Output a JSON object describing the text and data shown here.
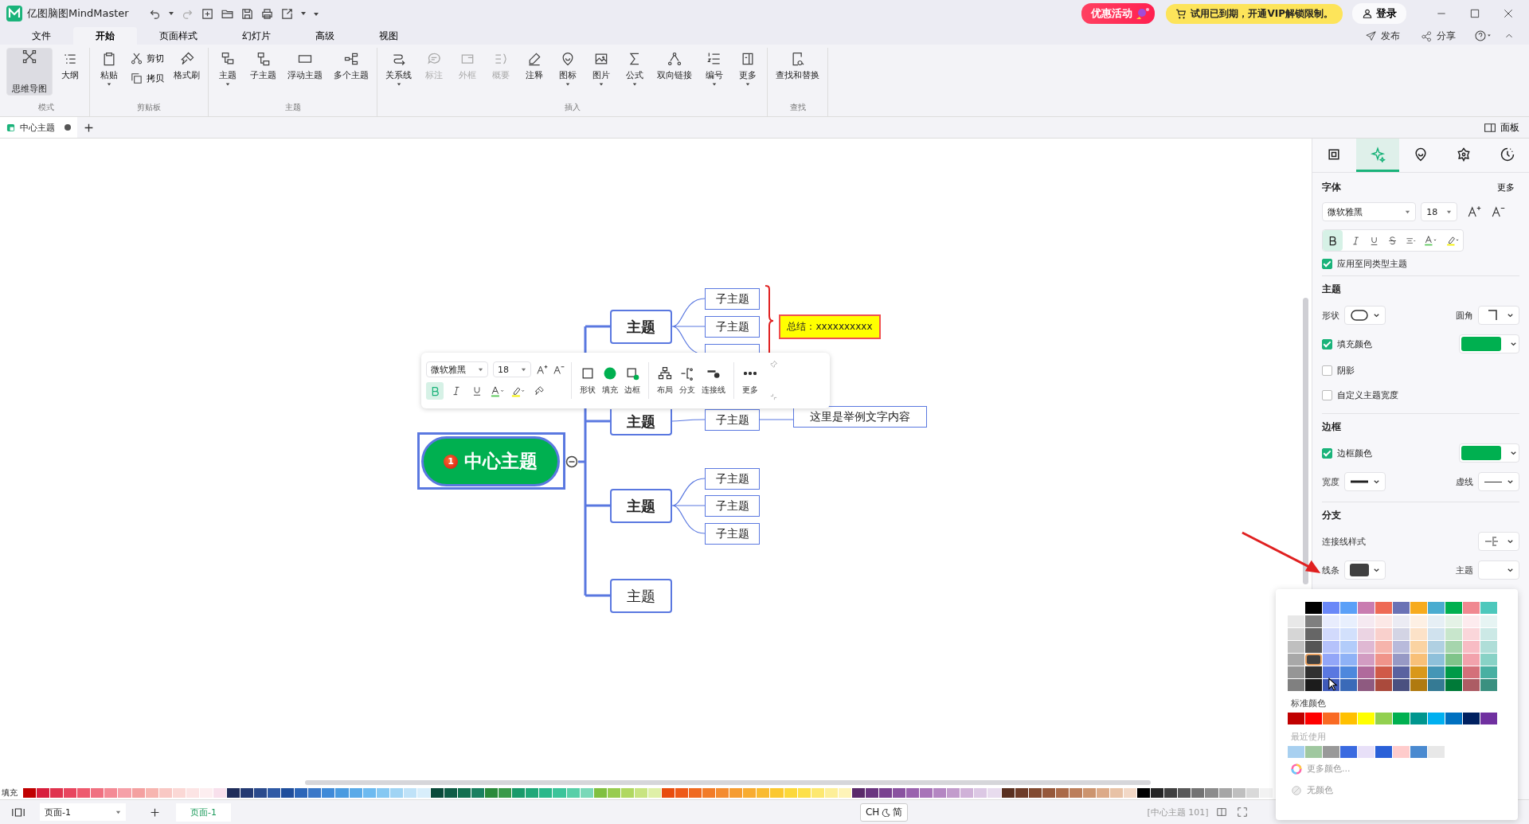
{
  "app": {
    "title": "亿图脑图MindMaster"
  },
  "promo": {
    "label": "优惠活动"
  },
  "vip_notice": {
    "label": "试用已到期，开通VIP解锁限制。"
  },
  "login": {
    "label": "登录"
  },
  "header_actions": [
    {
      "label": "发布"
    },
    {
      "label": "分享"
    }
  ],
  "menu_tabs": [
    {
      "label": "文件",
      "selected": false
    },
    {
      "label": "开始",
      "selected": true
    },
    {
      "label": "页面样式",
      "selected": false
    },
    {
      "label": "幻灯片",
      "selected": false
    },
    {
      "label": "高级",
      "selected": false
    },
    {
      "label": "视图",
      "selected": false
    }
  ],
  "ribbon_groups": [
    {
      "label": "模式",
      "items": [
        {
          "label": "思维导图",
          "kind": "large",
          "caret": false,
          "disabled": false,
          "selected": true
        },
        {
          "label": "大纲",
          "kind": "large",
          "caret": false,
          "disabled": false,
          "selected": false
        }
      ]
    },
    {
      "label": "剪贴板",
      "items": [
        {
          "label": "粘贴",
          "kind": "large",
          "caret": true,
          "disabled": false
        },
        {
          "label": "剪切",
          "kind": "small",
          "caret": false,
          "disabled": false
        },
        {
          "label": "拷贝",
          "kind": "small",
          "caret": false,
          "disabled": false
        },
        {
          "label": "格式刷",
          "kind": "large",
          "caret": false,
          "disabled": false
        }
      ]
    },
    {
      "label": "主题",
      "items": [
        {
          "label": "主题",
          "kind": "large",
          "caret": true,
          "disabled": false
        },
        {
          "label": "子主题",
          "kind": "large",
          "caret": false,
          "disabled": false
        },
        {
          "label": "浮动主题",
          "kind": "large",
          "caret": false,
          "disabled": false
        },
        {
          "label": "多个主题",
          "kind": "large",
          "caret": false,
          "disabled": false
        }
      ]
    },
    {
      "label": "插入",
      "items": [
        {
          "label": "关系线",
          "kind": "large",
          "caret": true,
          "disabled": false
        },
        {
          "label": "标注",
          "kind": "large",
          "caret": false,
          "disabled": true
        },
        {
          "label": "外框",
          "kind": "large",
          "caret": false,
          "disabled": true
        },
        {
          "label": "概要",
          "kind": "large",
          "caret": false,
          "disabled": true
        },
        {
          "label": "注释",
          "kind": "large",
          "caret": false,
          "disabled": false
        },
        {
          "label": "图标",
          "kind": "large",
          "caret": true,
          "disabled": false
        },
        {
          "label": "图片",
          "kind": "large",
          "caret": true,
          "disabled": false
        },
        {
          "label": "公式",
          "kind": "large",
          "caret": true,
          "disabled": false
        },
        {
          "label": "双向链接",
          "kind": "large",
          "caret": false,
          "disabled": false
        },
        {
          "label": "编号",
          "kind": "large",
          "caret": true,
          "disabled": false
        },
        {
          "label": "更多",
          "kind": "large",
          "caret": true,
          "disabled": false
        }
      ]
    },
    {
      "label": "查找",
      "items": [
        {
          "label": "查找和替换",
          "kind": "large",
          "caret": false,
          "disabled": false
        }
      ]
    }
  ],
  "document_tabs": [
    {
      "label": "中心主题",
      "unsaved": true,
      "selected": true
    }
  ],
  "panel_toggle": {
    "label": "面板"
  },
  "mind_map": {
    "central": {
      "label": "中心主题",
      "marker": "1",
      "selected": true
    },
    "topics": [
      {
        "label": "主题",
        "bold": true,
        "subtopics": [
          {
            "label": "子主题"
          },
          {
            "label": "子主题"
          },
          {
            "kind": "partial"
          }
        ],
        "summary": "总结：xxxxxxxxxx"
      },
      {
        "label": "主题",
        "bold": true,
        "subtopics": [
          {
            "label": "子主题",
            "detail": "这里是举例文字内容"
          }
        ]
      },
      {
        "label": "主题",
        "bold": true,
        "subtopics": [
          {
            "label": "子主题"
          },
          {
            "label": "子主题"
          },
          {
            "label": "子主题"
          }
        ]
      },
      {
        "label": "主题",
        "bold": false
      }
    ]
  },
  "floating_toolbar": {
    "font": "微软雅黑",
    "size": "18",
    "bold": true,
    "actions": [
      {
        "label": "形状"
      },
      {
        "label": "填充"
      },
      {
        "label": "边框"
      },
      {
        "label": "布局"
      },
      {
        "label": "分支"
      },
      {
        "label": "连接线"
      },
      {
        "label": "更多"
      }
    ]
  },
  "panel": {
    "tabs": [
      {
        "selected": false
      },
      {
        "selected": true
      },
      {
        "selected": false
      },
      {
        "selected": false
      },
      {
        "selected": false
      }
    ],
    "font_section": {
      "title": "字体",
      "more": "更多",
      "font": "微软雅黑",
      "size": "18",
      "bold": true,
      "apply_same": {
        "label": "应用至同类型主题",
        "checked": true
      }
    },
    "topic_section": {
      "title": "主题",
      "shape_label": "形状",
      "corner_label": "圆角",
      "fill": {
        "label": "填充颜色",
        "checked": true,
        "color": "#00b050"
      },
      "shadow": {
        "label": "阴影",
        "checked": false
      },
      "custom_width": {
        "label": "自定义主题宽度",
        "checked": false
      }
    },
    "border_section": {
      "title": "边框",
      "border_color": {
        "label": "边框颜色",
        "checked": true,
        "color": "#00b050"
      },
      "width_label": "宽度",
      "dash_label": "虚线"
    },
    "branch_section": {
      "title": "分支",
      "connector_label": "连接线样式",
      "line": {
        "label": "线条",
        "color": "#404040"
      },
      "topic_label": "主题"
    }
  },
  "color_picker": {
    "top_row": [
      {
        "color": "#000000"
      },
      {
        "color": "#6a88f8"
      },
      {
        "color": "#5aa0f8"
      },
      {
        "color": "#c97cb0"
      },
      {
        "color": "#ee6a55"
      },
      {
        "color": "#6a72b5"
      },
      {
        "color": "#f7ab1e"
      },
      {
        "color": "#4aacd0"
      },
      {
        "color": "#00b050"
      },
      {
        "color": "#f08890"
      },
      {
        "color": "#4dc8bc"
      }
    ],
    "shade_columns": [
      [
        {
          "color": "#e8e8e8",
          "selected": false
        },
        {
          "color": "#d6d6d6",
          "selected": false
        },
        {
          "color": "#bfbfbf",
          "selected": false
        },
        {
          "color": "#a8a8a8",
          "selected": false
        },
        {
          "color": "#969696",
          "selected": false
        },
        {
          "color": "#808080",
          "selected": false
        }
      ],
      [
        {
          "color": "#7f7f7f",
          "selected": false
        },
        {
          "color": "#666666",
          "selected": false
        },
        {
          "color": "#555555",
          "selected": false
        },
        {
          "color": "#404040",
          "selected": true
        },
        {
          "color": "#303030",
          "selected": false
        },
        {
          "color": "#1c1c1c",
          "selected": false
        }
      ],
      [
        {
          "color": "#e8ecfd",
          "selected": false
        },
        {
          "color": "#d2dafc",
          "selected": false
        },
        {
          "color": "#b5c2fb",
          "selected": false
        },
        {
          "color": "#93a6f8",
          "selected": false
        },
        {
          "color": "#5a78e0",
          "selected": false
        },
        {
          "color": "#3f5ab8",
          "selected": false
        }
      ],
      [
        {
          "color": "#e8effd",
          "selected": false
        },
        {
          "color": "#d2e0fc",
          "selected": false
        },
        {
          "color": "#b2ccfa",
          "selected": false
        },
        {
          "color": "#8eb2f6",
          "selected": false
        },
        {
          "color": "#4d88dd",
          "selected": false
        },
        {
          "color": "#3a6ab8",
          "selected": false
        }
      ],
      [
        {
          "color": "#f5e9f1",
          "selected": false
        },
        {
          "color": "#ebd4e3",
          "selected": false
        },
        {
          "color": "#dfb8d3",
          "selected": false
        },
        {
          "color": "#d29cc2",
          "selected": false
        },
        {
          "color": "#b06a9c",
          "selected": false
        },
        {
          "color": "#8e5a80",
          "selected": false
        }
      ],
      [
        {
          "color": "#fce8e6",
          "selected": false
        },
        {
          "color": "#f9d0cc",
          "selected": false
        },
        {
          "color": "#f6b4ac",
          "selected": false
        },
        {
          "color": "#f0948a",
          "selected": false
        },
        {
          "color": "#d05a48",
          "selected": false
        },
        {
          "color": "#aa4a3c",
          "selected": false
        }
      ],
      [
        {
          "color": "#ebebf3",
          "selected": false
        },
        {
          "color": "#d3d4e4",
          "selected": false
        },
        {
          "color": "#b8badb",
          "selected": false
        },
        {
          "color": "#9799c5",
          "selected": false
        },
        {
          "color": "#5a62a0",
          "selected": false
        },
        {
          "color": "#4a5080",
          "selected": false
        }
      ],
      [
        {
          "color": "#fdf0e4",
          "selected": false
        },
        {
          "color": "#fce2c8",
          "selected": false
        },
        {
          "color": "#fad3a2",
          "selected": false
        },
        {
          "color": "#f8c078",
          "selected": false
        },
        {
          "color": "#d9981a",
          "selected": false
        },
        {
          "color": "#b07a10",
          "selected": false
        }
      ],
      [
        {
          "color": "#e6eff5",
          "selected": false
        },
        {
          "color": "#d0e2ee",
          "selected": false
        },
        {
          "color": "#b0d0e2",
          "selected": false
        },
        {
          "color": "#8ec0da",
          "selected": false
        },
        {
          "color": "#4496b6",
          "selected": false
        },
        {
          "color": "#357a94",
          "selected": false
        }
      ],
      [
        {
          "color": "#e4f2e6",
          "selected": false
        },
        {
          "color": "#c8e6cc",
          "selected": false
        },
        {
          "color": "#a6d5ad",
          "selected": false
        },
        {
          "color": "#80c48a",
          "selected": false
        },
        {
          "color": "#009a48",
          "selected": false
        },
        {
          "color": "#007a38",
          "selected": false
        }
      ],
      [
        {
          "color": "#fdebee",
          "selected": false
        },
        {
          "color": "#fad6da",
          "selected": false
        },
        {
          "color": "#f8bcc4",
          "selected": false
        },
        {
          "color": "#f2a2ac",
          "selected": false
        },
        {
          "color": "#d4707a",
          "selected": false
        },
        {
          "color": "#ac5c64",
          "selected": false
        }
      ],
      [
        {
          "color": "#e6f4f3",
          "selected": false
        },
        {
          "color": "#cce9e6",
          "selected": false
        },
        {
          "color": "#afded8",
          "selected": false
        },
        {
          "color": "#88d2c6",
          "selected": false
        },
        {
          "color": "#48b0a2",
          "selected": false
        },
        {
          "color": "#3a9080",
          "selected": false
        }
      ]
    ],
    "standard_label": "标准颜色",
    "standard": [
      {
        "color": "#c00000"
      },
      {
        "color": "#ff0000"
      },
      {
        "color": "#f96a24"
      },
      {
        "color": "#ffc000"
      },
      {
        "color": "#ffff00"
      },
      {
        "color": "#92d050"
      },
      {
        "color": "#00b050"
      },
      {
        "color": "#00968e"
      },
      {
        "color": "#00b0f0"
      },
      {
        "color": "#0070c0"
      },
      {
        "color": "#002060"
      },
      {
        "color": "#7030a0"
      }
    ],
    "recent_label": "最近使用",
    "recent": [
      {
        "color": "#a8d0f0"
      },
      {
        "color": "#a0c8a0"
      },
      {
        "color": "#999999"
      },
      {
        "color": "#3a6ae0"
      },
      {
        "color": "#e8e0f8"
      },
      {
        "color": "#2a60d8"
      },
      {
        "color": "#ffcccc"
      },
      {
        "color": "#4a8ad0"
      },
      {
        "color": "#e8e8e8"
      }
    ],
    "more_colors": "更多颜色...",
    "no_color": "无颜色"
  },
  "color_strip": {
    "label": "填充",
    "colors": [
      {
        "color": "#c00000"
      },
      {
        "color": "#d81e3c"
      },
      {
        "color": "#e0334d"
      },
      {
        "color": "#e8455e"
      },
      {
        "color": "#ee5a6e"
      },
      {
        "color": "#f07080"
      },
      {
        "color": "#f48a95"
      },
      {
        "color": "#f6a0a8"
      },
      {
        "color": "#f4a0a0"
      },
      {
        "color": "#f7b5b0"
      },
      {
        "color": "#f9c8c4"
      },
      {
        "color": "#fbd8d5"
      },
      {
        "color": "#fce4e4"
      },
      {
        "color": "#fdeef0"
      },
      {
        "color": "#f8e0ec"
      },
      {
        "color": "#1f2d5a"
      },
      {
        "color": "#243a73"
      },
      {
        "color": "#2a4a8c"
      },
      {
        "color": "#2f5aa5"
      },
      {
        "color": "#1f4e9c"
      },
      {
        "color": "#2b65b8"
      },
      {
        "color": "#3b78c8"
      },
      {
        "color": "#3f8ad8"
      },
      {
        "color": "#4a9be0"
      },
      {
        "color": "#5aaae8"
      },
      {
        "color": "#6dbaf0"
      },
      {
        "color": "#86c8f2"
      },
      {
        "color": "#a0d4f4"
      },
      {
        "color": "#bfe2f8"
      },
      {
        "color": "#d8eefb"
      },
      {
        "color": "#0b4a3a"
      },
      {
        "color": "#0f5c46"
      },
      {
        "color": "#137050"
      },
      {
        "color": "#1a8060"
      },
      {
        "color": "#2a8a3a"
      },
      {
        "color": "#3a9a4a"
      },
      {
        "color": "#1a9a6a"
      },
      {
        "color": "#20a878"
      },
      {
        "color": "#2ab88a"
      },
      {
        "color": "#3cc49a"
      },
      {
        "color": "#58cfa8"
      },
      {
        "color": "#7ad8b8"
      },
      {
        "color": "#80c040"
      },
      {
        "color": "#98cc50"
      },
      {
        "color": "#b0d860"
      },
      {
        "color": "#c8e480"
      },
      {
        "color": "#dff0a8"
      },
      {
        "color": "#e84d0e"
      },
      {
        "color": "#ee5a18"
      },
      {
        "color": "#f06a20"
      },
      {
        "color": "#f27c28"
      },
      {
        "color": "#f48c30"
      },
      {
        "color": "#f69c30"
      },
      {
        "color": "#f8ac30"
      },
      {
        "color": "#f9bb30"
      },
      {
        "color": "#fbc830"
      },
      {
        "color": "#fcd83a"
      },
      {
        "color": "#fde04a"
      },
      {
        "color": "#fde870"
      },
      {
        "color": "#fdef98"
      },
      {
        "color": "#fef4b8"
      },
      {
        "color": "#5a2a6a"
      },
      {
        "color": "#6a3580"
      },
      {
        "color": "#7a4290"
      },
      {
        "color": "#8a52a0"
      },
      {
        "color": "#9a62ae"
      },
      {
        "color": "#a874b8"
      },
      {
        "color": "#b486c2"
      },
      {
        "color": "#c29ccc"
      },
      {
        "color": "#d0b2d8"
      },
      {
        "color": "#dcc8e4"
      },
      {
        "color": "#e8dcee"
      },
      {
        "color": "#5a3020"
      },
      {
        "color": "#6e3c28"
      },
      {
        "color": "#824a30"
      },
      {
        "color": "#96583a"
      },
      {
        "color": "#aa6a48"
      },
      {
        "color": "#bc7e5a"
      },
      {
        "color": "#cc946e"
      },
      {
        "color": "#dcaa88"
      },
      {
        "color": "#e8c2a6"
      },
      {
        "color": "#f2d8c6"
      },
      {
        "color": "#000000"
      },
      {
        "color": "#262626"
      },
      {
        "color": "#404040"
      },
      {
        "color": "#595959"
      },
      {
        "color": "#737373"
      },
      {
        "color": "#8c8c8c"
      },
      {
        "color": "#a6a6a6"
      },
      {
        "color": "#bfbfbf"
      },
      {
        "color": "#d9d9d9"
      },
      {
        "color": "#f2f2f2"
      }
    ]
  },
  "status_bar": {
    "page_select": "页面-1",
    "page_tabs": [
      {
        "label": "页面-1",
        "selected": true
      }
    ],
    "ime": {
      "lang": "CH",
      "mode": "简"
    },
    "selection_info": "[中心主题 101]"
  }
}
